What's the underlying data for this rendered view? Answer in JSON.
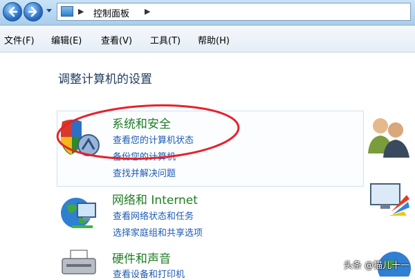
{
  "address_bar": {
    "path": "控制面板"
  },
  "menu": {
    "items": [
      "文件(F)",
      "编辑(E)",
      "查看(V)",
      "工具(T)",
      "帮助(H)"
    ]
  },
  "page": {
    "title": "调整计算机的设置"
  },
  "categories": [
    {
      "title": "系统和安全",
      "links": [
        "查看您的计算机状态",
        "备份您的计算机",
        "查找并解决问题"
      ]
    },
    {
      "title": "网络和 Internet",
      "links": [
        "查看网络状态和任务",
        "选择家庭组和共享选项"
      ]
    },
    {
      "title": "硬件和声音",
      "links": [
        "查看设备和打印机"
      ]
    }
  ],
  "watermark": "头条 @猫儿十一",
  "colors": {
    "highlight_ellipse": "#e8202a",
    "category_title": "#1e7d24",
    "link": "#1c5ab5"
  }
}
